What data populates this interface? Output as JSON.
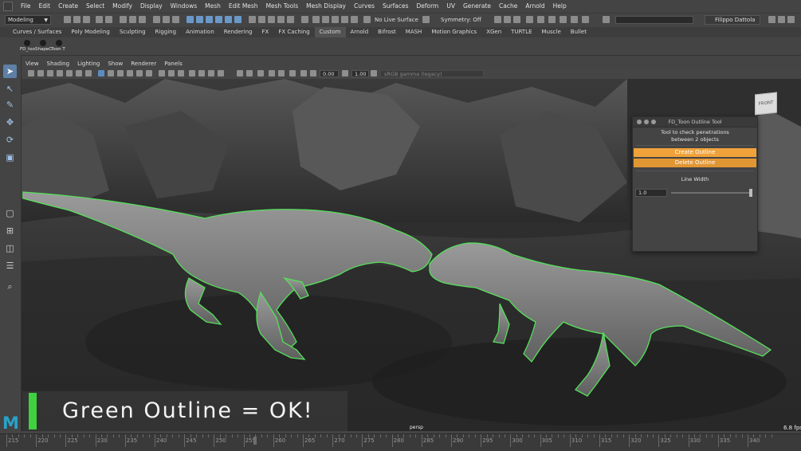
{
  "menubar": {
    "items": [
      "File",
      "Edit",
      "Create",
      "Select",
      "Modify",
      "Display",
      "Windows",
      "Mesh",
      "Edit Mesh",
      "Mesh Tools",
      "Mesh Display",
      "Curves",
      "Surfaces",
      "Deform",
      "UV",
      "Generate",
      "Cache",
      "Arnold",
      "Help"
    ]
  },
  "statusline": {
    "mode": "Modeling",
    "live_surface": "No Live Surface",
    "symmetry": "Symmetry: Off",
    "user": "Filippo Dattola"
  },
  "shelf": {
    "tabs": [
      "Curves / Surfaces",
      "Poly Modeling",
      "Sculpting",
      "Rigging",
      "Animation",
      "Rendering",
      "FX",
      "FX Caching",
      "Custom",
      "Arnold",
      "Bifrost",
      "MASH",
      "Motion Graphics",
      "XGen",
      "TURTLE",
      "Muscle",
      "Bullet"
    ],
    "active_tab": "Custom",
    "buttons": [
      {
        "label": "FD_too"
      },
      {
        "label": "ShapeC"
      },
      {
        "label": "Toon T"
      }
    ]
  },
  "panel": {
    "menu": [
      "View",
      "Shading",
      "Lighting",
      "Show",
      "Renderer",
      "Panels"
    ],
    "field_a": "0.00",
    "field_b": "1.00",
    "color_space": "sRGB gamma (legacy)"
  },
  "viewport": {
    "camera": "persp",
    "fps": "6.8 fps",
    "viewcube_label": "FRONT"
  },
  "tool_window": {
    "title": "FD_Toon Outline Tool",
    "description_line1": "Tool to check penetrations",
    "description_line2": "between 2 objects",
    "create_label": "Create Outline",
    "delete_label": "Delete Outline",
    "line_width_label": "Line Width",
    "line_width_value": "1.0",
    "line_width_fraction": 1.0,
    "button_color": "#f0a23a"
  },
  "caption": {
    "text": "Green Outline = OK!",
    "accent_color": "#3fd13f"
  },
  "outline_color": "#55e05a",
  "timeline": {
    "labels": [
      "215",
      "220",
      "225",
      "230",
      "235",
      "240",
      "245",
      "250",
      "255",
      "260",
      "265",
      "270",
      "275",
      "280",
      "285",
      "290",
      "295",
      "300",
      "305",
      "310",
      "315",
      "320",
      "325",
      "330",
      "335",
      "340"
    ]
  }
}
